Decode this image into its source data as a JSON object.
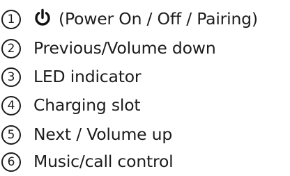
{
  "items": [
    {
      "number": "1",
      "icon": "power-icon",
      "text": "(Power On / Off / Pairing)"
    },
    {
      "number": "2",
      "text": "Previous/Volume down"
    },
    {
      "number": "3",
      "text": "LED indicator"
    },
    {
      "number": "4",
      "text": "Charging slot"
    },
    {
      "number": "5",
      "text": "Next / Volume up"
    },
    {
      "number": "6",
      "text": "Music/call control"
    }
  ]
}
